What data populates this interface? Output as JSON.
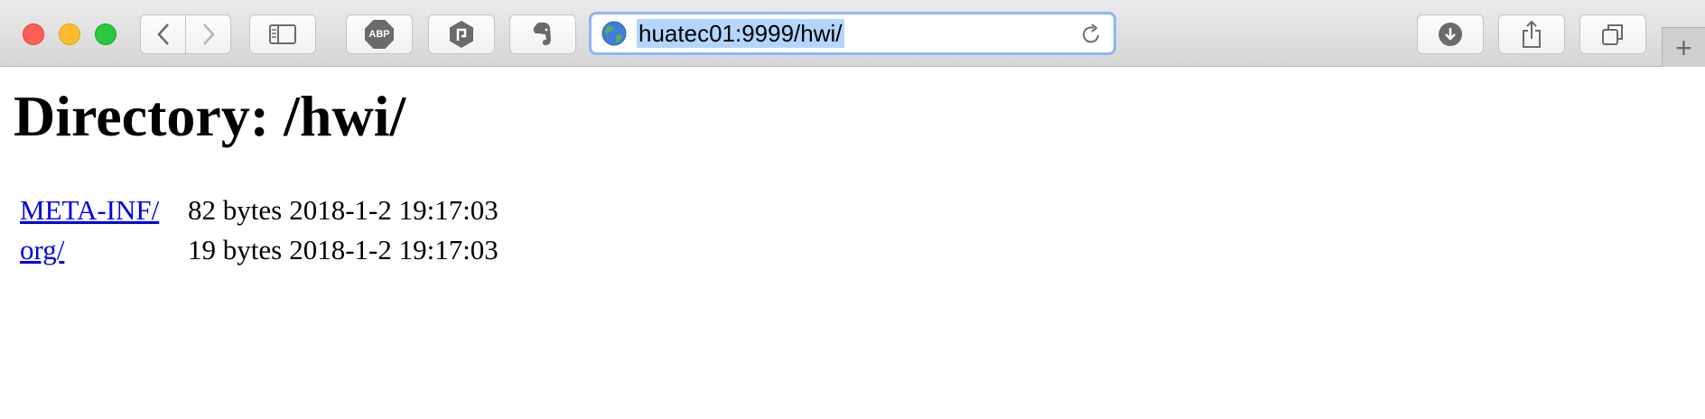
{
  "browser": {
    "url": "huatec01:9999/hwi/",
    "abp_label": "ABP",
    "new_tab_symbol": "+"
  },
  "page": {
    "heading": "Directory: /hwi/",
    "entries": [
      {
        "name": "META-INF/",
        "size": "82 bytes",
        "modified": "2018-1-2 19:17:03"
      },
      {
        "name": "org/",
        "size": "19 bytes",
        "modified": "2018-1-2 19:17:03"
      }
    ]
  }
}
